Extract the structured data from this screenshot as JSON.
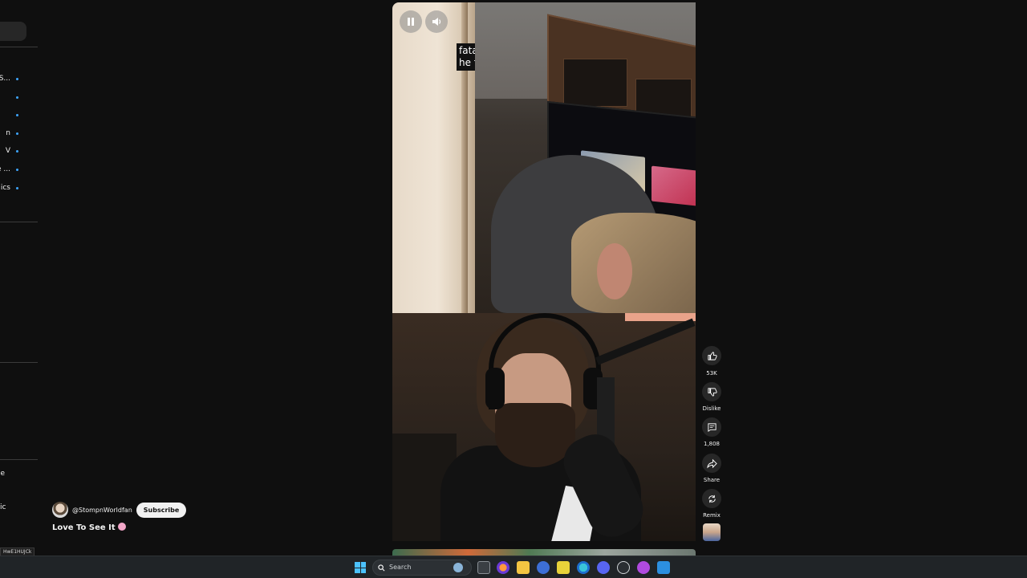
{
  "sidebar": {
    "items": [
      {
        "label": "n S..."
      },
      {
        "label": ""
      },
      {
        "label": ""
      },
      {
        "label": "n"
      },
      {
        "label": "V"
      },
      {
        "label": "ore ..."
      },
      {
        "label": "ics"
      }
    ],
    "lower_items": [
      {
        "label": "e"
      },
      {
        "label": "ic"
      }
    ]
  },
  "video": {
    "caption_lines": [
      "fata",
      "he f"
    ],
    "pause_icon": "pause-icon",
    "volume_icon": "volume-icon"
  },
  "actions": {
    "like_count": "53K",
    "dislike_label": "Dislike",
    "comment_count": "1,808",
    "share_label": "Share",
    "remix_label": "Remix"
  },
  "channel": {
    "handle": "@StompnWorldfan",
    "subscribe_label": "Subscribe"
  },
  "short": {
    "title": "Love To See It"
  },
  "url_tooltip": "HwE1HUJCk",
  "taskbar": {
    "search_label": "Search"
  },
  "colors": {
    "background": "#0f0f0f",
    "accent_dot": "#3ea6ff",
    "taskbar": "#202427"
  }
}
